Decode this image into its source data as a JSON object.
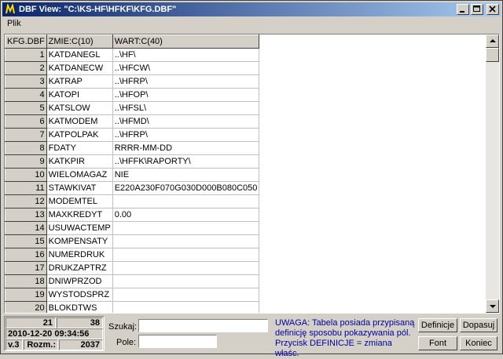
{
  "window": {
    "title": "DBF View: \"C:\\KS-HF\\HFKF\\KFG.DBF\""
  },
  "menu": {
    "plik": "Plik"
  },
  "grid": {
    "headers": [
      "KFG.DBF",
      "ZMIE:C(10)",
      "WART:C(40)"
    ],
    "rows": [
      {
        "n": "1",
        "zmie": "KATDANEGL",
        "wart": "..\\HF\\"
      },
      {
        "n": "2",
        "zmie": "KATDANECW",
        "wart": "..\\HFCW\\"
      },
      {
        "n": "3",
        "zmie": "KATRAP",
        "wart": "..\\HFRP\\"
      },
      {
        "n": "4",
        "zmie": "KATOPI",
        "wart": "..\\HFOP\\"
      },
      {
        "n": "5",
        "zmie": "KATSLOW",
        "wart": "..\\HFSL\\"
      },
      {
        "n": "6",
        "zmie": "KATMODEM",
        "wart": "..\\HFMD\\"
      },
      {
        "n": "7",
        "zmie": "KATPOLPAK",
        "wart": "..\\HFRP\\"
      },
      {
        "n": "8",
        "zmie": "FDATY",
        "wart": "RRRR-MM-DD"
      },
      {
        "n": "9",
        "zmie": "KATKPIR",
        "wart": "..\\HFFK\\RAPORTY\\"
      },
      {
        "n": "10",
        "zmie": "WIELOMAGAZ",
        "wart": "NIE"
      },
      {
        "n": "11",
        "zmie": "STAWKIVAT",
        "wart": "E220A230F070G030D000B080C050"
      },
      {
        "n": "12",
        "zmie": "MODEMTEL",
        "wart": ""
      },
      {
        "n": "13",
        "zmie": "MAXKREDYT",
        "wart": "0.00"
      },
      {
        "n": "14",
        "zmie": "USUWACTEMP",
        "wart": ""
      },
      {
        "n": "15",
        "zmie": "KOMPENSATY",
        "wart": ""
      },
      {
        "n": "16",
        "zmie": "NUMERDRUK",
        "wart": ""
      },
      {
        "n": "17",
        "zmie": "DRUKZAPTRZ",
        "wart": ""
      },
      {
        "n": "18",
        "zmie": "DNIWPRZOD",
        "wart": ""
      },
      {
        "n": "19",
        "zmie": "WYSTODSPRZ",
        "wart": ""
      },
      {
        "n": "20",
        "zmie": "BLOKDTWS",
        "wart": ""
      }
    ]
  },
  "status": {
    "records": "21",
    "current": "38",
    "datetime": "2010-12-20 09:34:56",
    "version": "v.3",
    "size_label": "Rozm.:",
    "size_value": "2037"
  },
  "search": {
    "szukaj_label": "Szukaj:",
    "szukaj_value": "",
    "pole_label": "Pole:",
    "pole_value": ""
  },
  "warning": {
    "line1": "UWAGA: Tabela posiada przypisaną",
    "line2": "definicję sposobu pokazywania pól.",
    "line3": "Przycisk DEFINICJE = zmiana właśc."
  },
  "buttons": {
    "definicje": "Definicje",
    "dopasuj": "Dopasuj",
    "font": "Font",
    "koniec": "Koniec"
  },
  "colors": {
    "title_start": "#0a246a",
    "title_end": "#a6caf0",
    "warning_text": "#0000a0",
    "face": "#d4d0c8"
  }
}
